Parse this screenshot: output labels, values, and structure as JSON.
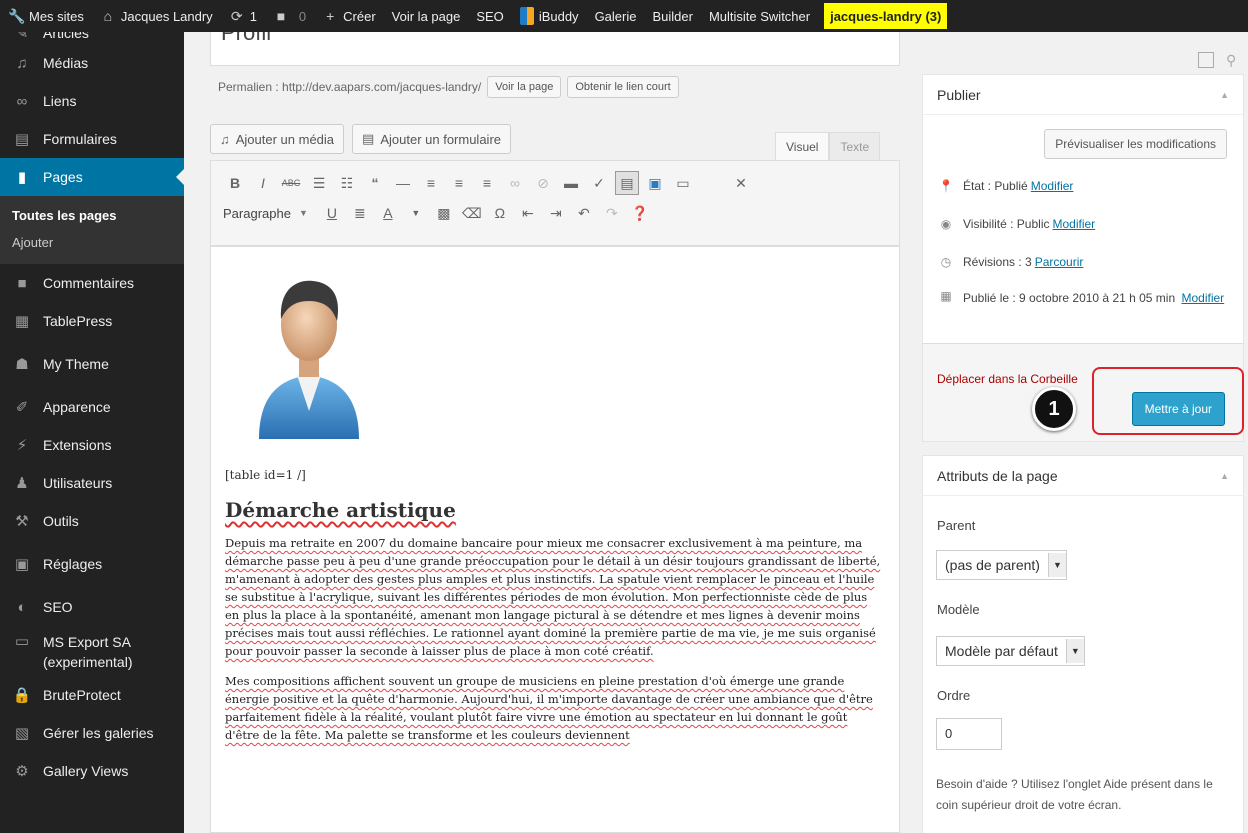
{
  "adminbar": {
    "my_sites": "Mes sites",
    "site_name": "Jacques Landry",
    "updates_count": "1",
    "comments_count": "0",
    "create": "Créer",
    "view_page": "Voir la page",
    "seo": "SEO",
    "ibuddy": "iBuddy",
    "gallery": "Galerie",
    "builder": "Builder",
    "multisite_switcher": "Multisite Switcher",
    "user_site": "jacques-landry (3)"
  },
  "sidebar": {
    "items": [
      {
        "label": "Articles",
        "icon": "pin-icon"
      },
      {
        "label": "Médias",
        "icon": "media-icon"
      },
      {
        "label": "Liens",
        "icon": "link-icon"
      },
      {
        "label": "Formulaires",
        "icon": "form-icon"
      },
      {
        "label": "Pages",
        "icon": "pages-icon"
      },
      {
        "label": "Commentaires",
        "icon": "comment-icon"
      },
      {
        "label": "TablePress",
        "icon": "table-icon"
      },
      {
        "label": "My Theme",
        "icon": "theme-icon"
      },
      {
        "label": "Apparence",
        "icon": "brush-icon"
      },
      {
        "label": "Extensions",
        "icon": "plugin-icon"
      },
      {
        "label": "Utilisateurs",
        "icon": "users-icon"
      },
      {
        "label": "Outils",
        "icon": "wrench-icon"
      },
      {
        "label": "Réglages",
        "icon": "settings-icon"
      },
      {
        "label": "SEO",
        "icon": "seo-icon"
      },
      {
        "label": "MS Export SA (experimental)",
        "icon": "export-icon"
      },
      {
        "label": "BruteProtect",
        "icon": "lock-icon"
      },
      {
        "label": "Gérer les galeries",
        "icon": "gallery-icon"
      },
      {
        "label": "Gallery Views",
        "icon": "gear-icon"
      }
    ],
    "submenu": {
      "all_pages": "Toutes les pages",
      "add": "Ajouter"
    }
  },
  "editor": {
    "title": "Profil",
    "permalink_label": "Permalien : http://dev.aapars.com/jacques-landry/",
    "view_page_button": "Voir la page",
    "shortlink_button": "Obtenir le lien court",
    "add_media": "Ajouter un média",
    "add_form": "Ajouter un formulaire",
    "tab_visual": "Visuel",
    "tab_text": "Texte",
    "format_select": "Paragraphe",
    "shortcode": "[table id=1 /]",
    "heading": "Démarche artistique",
    "paragraph1": "Depuis ma retraite en 2007 du domaine bancaire pour mieux me consacrer exclusivement à ma peinture,  ma démarche passe peu à peu d'une grande préoccupation pour le détail à un désir toujours grandissant de liberté, m'amenant à adopter des gestes plus amples et plus instinctifs. La spatule vient remplacer le pinceau et l'huile se substitue à l'acrylique, suivant les différentes périodes de mon évolution. Mon perfectionniste cède de plus en plus la place à la spontanéité, amenant mon langage pictural à se détendre et mes lignes à devenir moins précises mais tout aussi réfléchies. Le rationnel ayant  dominé la première partie de ma vie, je me suis organisé pour pouvoir passer la seconde à laisser plus de place à mon coté créatif.",
    "paragraph2": "Mes compositions affichent souvent un groupe de musiciens en pleine prestation d'où émerge une grande énergie positive et la quête  d'harmonie. Aujourd'hui, il m'importe davantage de créer une ambiance que d'être parfaitement fidèle à la réalité, voulant plutôt faire vivre une émotion au spectateur en lui donnant le goût d'être de la fête. Ma palette  se transforme et les couleurs deviennent"
  },
  "publish": {
    "title": "Publier",
    "preview_button": "Prévisualiser les modifications",
    "status_label": "État : Publié",
    "status_link": "Modifier",
    "visibility_label": "Visibilité : Public",
    "visibility_link": "Modifier",
    "revisions_label": "Révisions : 3",
    "revisions_link": "Parcourir",
    "published_label": "Publié le : 9 octobre 2010 à 21 h 05 min",
    "published_link": "Modifier",
    "trash_link": "Déplacer dans la Corbeille",
    "update_button": "Mettre à jour",
    "step_number": "1"
  },
  "page_attributes": {
    "title": "Attributs de la page",
    "parent_label": "Parent",
    "parent_value": "(pas de parent)",
    "template_label": "Modèle",
    "template_value": "Modèle par défaut",
    "order_label": "Ordre",
    "order_value": "0",
    "help_text": "Besoin d'aide ? Utilisez l'onglet Aide présent dans le coin supérieur droit de votre écran."
  },
  "colors": {
    "adminbar_bg": "#222222",
    "accent": "#0074a2",
    "button_primary": "#2ea2cc",
    "highlight_yellow": "#ffff00",
    "annotation_red": "#d9232d",
    "trash_red": "#aa0000"
  }
}
